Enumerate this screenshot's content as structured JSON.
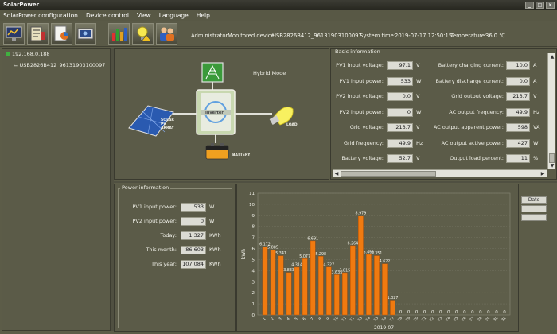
{
  "window": {
    "title": "SolarPower"
  },
  "menu": [
    "SolarPower configuration",
    "Device control",
    "View",
    "Language",
    "Help"
  ],
  "status": {
    "user": "Administrator",
    "monitored_label": "Monitored device:",
    "monitored_device": "USB2826B412_96131903100097",
    "time_label": "System time:",
    "time_value": "2019-07-17 12:50:15",
    "temp_label": "Temperature:",
    "temp_value": "36.0 ℃"
  },
  "tree": {
    "host": "192.168.0.188",
    "device": "USB2826B412_96131903100097"
  },
  "diagram": {
    "mode": "Hybrid Mode",
    "inverter_label": "Inverter",
    "solar_label": "SOLAR PV ARRAY",
    "load_label": "LOAD",
    "battery_label": "BATTERY"
  },
  "basic": {
    "title": "Basic information",
    "left": [
      {
        "label": "PV1 input voltage:",
        "value": "97.1",
        "unit": "V"
      },
      {
        "label": "PV1 input power:",
        "value": "533",
        "unit": "W"
      },
      {
        "label": "PV2 input voltage:",
        "value": "0.0",
        "unit": "V"
      },
      {
        "label": "PV2 input power:",
        "value": "0",
        "unit": "W"
      },
      {
        "label": "Grid voltage:",
        "value": "213.7",
        "unit": "V"
      },
      {
        "label": "Grid frequency:",
        "value": "49.9",
        "unit": "Hz"
      },
      {
        "label": "Battery voltage:",
        "value": "52.7",
        "unit": "V"
      }
    ],
    "right": [
      {
        "label": "Battery charging current:",
        "value": "10.0",
        "unit": "A"
      },
      {
        "label": "Battery discharge current:",
        "value": "0.0",
        "unit": "A"
      },
      {
        "label": "Grid output voltage:",
        "value": "213.7",
        "unit": "V"
      },
      {
        "label": "AC output frequency:",
        "value": "49.9",
        "unit": "Hz"
      },
      {
        "label": "AC output apparent power:",
        "value": "598",
        "unit": "VA"
      },
      {
        "label": "AC output active power:",
        "value": "427",
        "unit": "W"
      },
      {
        "label": "Output load percent:",
        "value": "11",
        "unit": "%"
      }
    ]
  },
  "power": {
    "title": "Power information",
    "rows": [
      {
        "label": "PV1 input power:",
        "value": "533",
        "unit": "W"
      },
      {
        "label": "PV2 input power:",
        "value": "0",
        "unit": "W"
      },
      {
        "label": "Today:",
        "value": "1.327",
        "unit": "KWh"
      },
      {
        "label": "This month:",
        "value": "86.603",
        "unit": "KWh"
      },
      {
        "label": "This year:",
        "value": "107.084",
        "unit": "KWh"
      }
    ]
  },
  "side_buttons": [
    "Date",
    "",
    ""
  ],
  "colors": {
    "bar": "#f07a10",
    "background": "#5b5b48"
  },
  "chart_data": {
    "type": "bar",
    "categories": [
      "1",
      "2",
      "3",
      "4",
      "5",
      "6",
      "7",
      "8",
      "9",
      "10",
      "11",
      "12",
      "13",
      "14",
      "15",
      "16",
      "17",
      "18",
      "19",
      "20",
      "21",
      "22",
      "23",
      "24",
      "25",
      "26",
      "27",
      "28",
      "29",
      "30",
      "31"
    ],
    "values": [
      6.172,
      5.885,
      5.341,
      3.833,
      4.314,
      5.077,
      6.691,
      5.298,
      4.327,
      3.633,
      3.815,
      6.264,
      8.979,
      5.466,
      5.351,
      4.622,
      1.327,
      0,
      0,
      0,
      0,
      0,
      0,
      0,
      0,
      0,
      0,
      0,
      0,
      0,
      0
    ],
    "labels": [
      "6.172",
      "5.885",
      "5.341",
      "3.833",
      "4.314",
      "5.077",
      "6.691",
      "5.298",
      "4.327",
      "3.633",
      "3.815",
      "6.264",
      "8.979",
      "5.466",
      "5.351",
      "4.622",
      "1.327",
      "0",
      "0",
      "0",
      "0",
      "0",
      "0",
      "0",
      "0",
      "0",
      "0",
      "0",
      "0",
      "0",
      "0"
    ],
    "xlabel": "2019-07",
    "ylabel": "kWh",
    "ylim": [
      0,
      11
    ],
    "yticks": [
      "0",
      "1",
      "2",
      "3",
      "4",
      "5",
      "6",
      "7",
      "8",
      "9",
      "10",
      "11"
    ],
    "grid": true
  }
}
